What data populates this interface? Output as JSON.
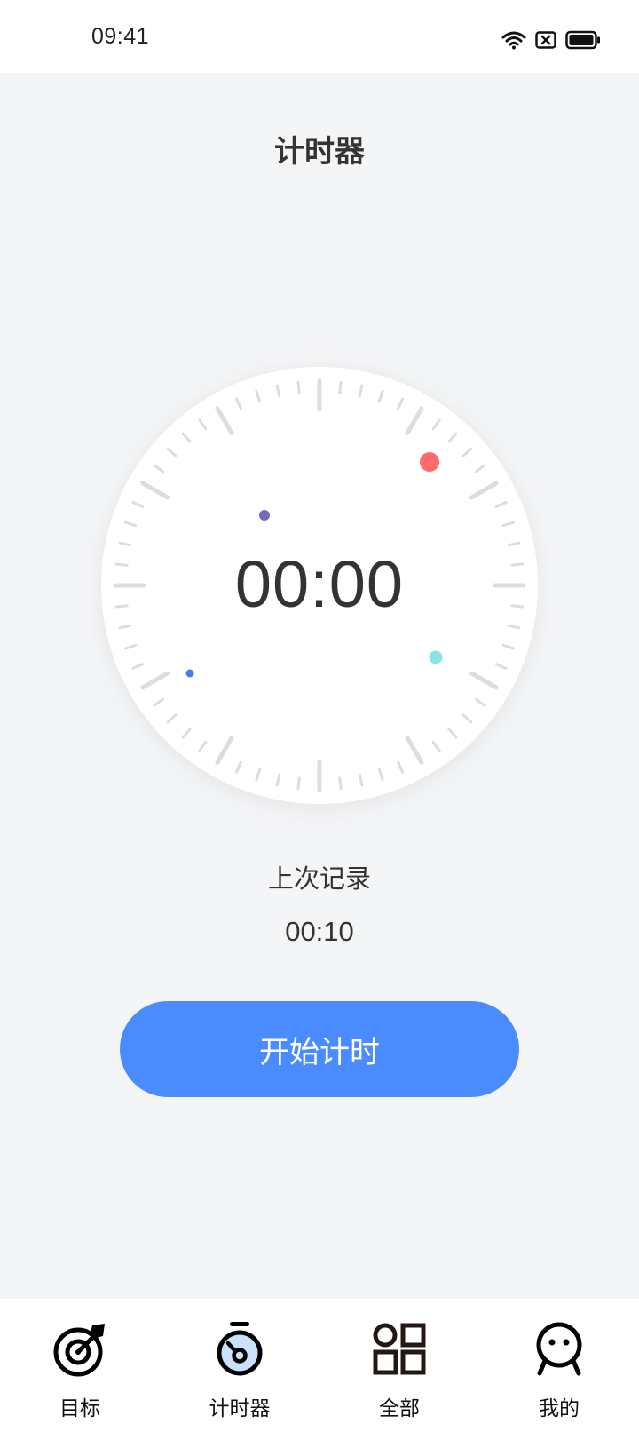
{
  "status_bar": {
    "time": "09:41",
    "icons": [
      "wifi-icon",
      "sim-blocked-icon",
      "battery-icon"
    ]
  },
  "header": {
    "title": "计时器"
  },
  "timer": {
    "display": "00:00",
    "dots": [
      {
        "name": "red-dot",
        "color": "#ff6b6b"
      },
      {
        "name": "purple-dot",
        "color": "#7a6ab5"
      },
      {
        "name": "cyan-dot",
        "color": "#8ae3e8"
      },
      {
        "name": "blue-dot",
        "color": "#3f7cf5"
      }
    ]
  },
  "last_record": {
    "label": "上次记录",
    "value": "00:10"
  },
  "actions": {
    "start_label": "开始计时"
  },
  "colors": {
    "accent": "#4a8cff",
    "background": "#f4f5f7",
    "tick": "#dddddd"
  },
  "tab_bar": {
    "items": [
      {
        "label": "目标",
        "icon": "target-icon",
        "active": false
      },
      {
        "label": "计时器",
        "icon": "stopwatch-icon",
        "active": true
      },
      {
        "label": "全部",
        "icon": "grid-icon",
        "active": false
      },
      {
        "label": "我的",
        "icon": "profile-icon",
        "active": false
      }
    ]
  }
}
